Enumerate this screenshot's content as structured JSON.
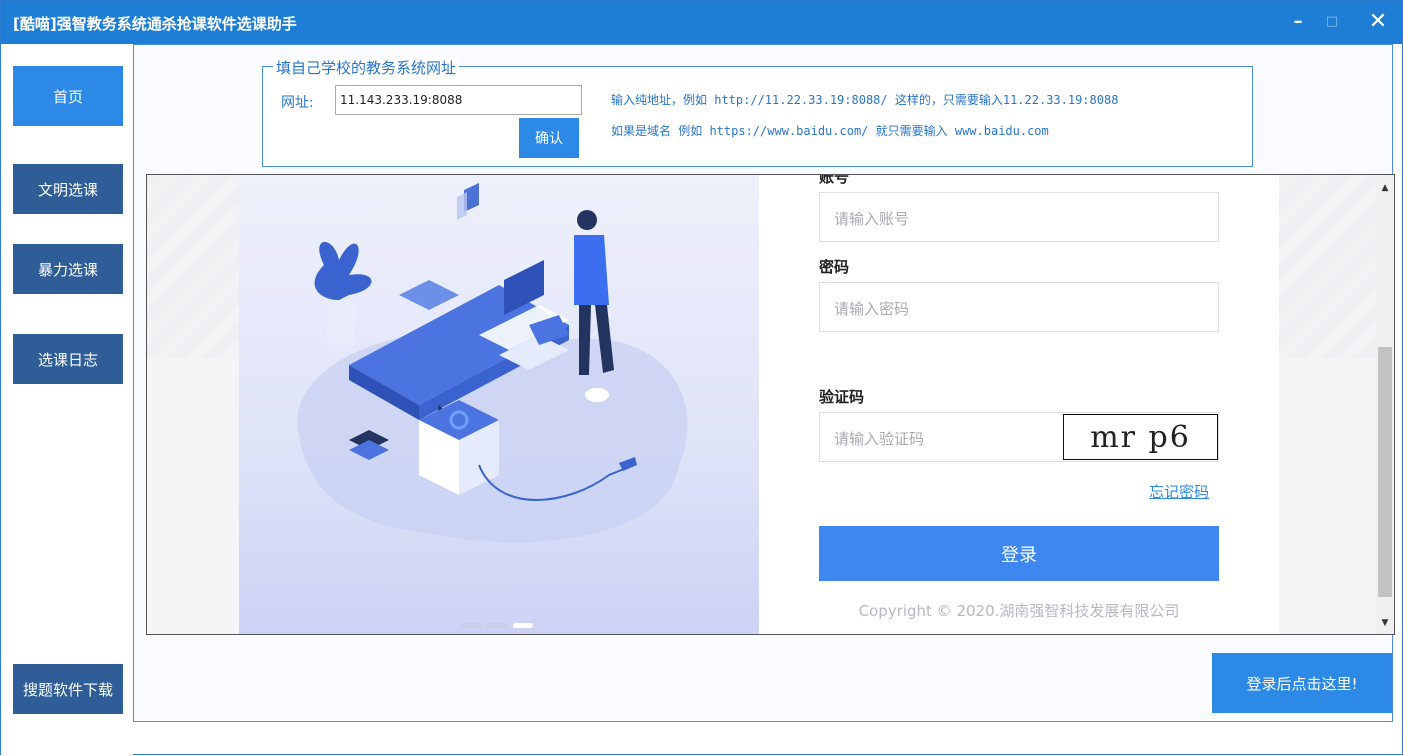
{
  "window": {
    "title": "[酷喵]强智教务系统通杀抢课软件选课助手",
    "controls": {
      "minimize": "–",
      "maximize": "□",
      "close": "✕"
    }
  },
  "sidebar": {
    "items": [
      {
        "label": "首页",
        "active": true
      },
      {
        "label": "文明选课"
      },
      {
        "label": "暴力选课"
      },
      {
        "label": "选课日志"
      }
    ],
    "download_label": "搜题软件下载"
  },
  "url_panel": {
    "legend": "填自己学校的教务系统网址",
    "field_label": "网址:",
    "url_value": "11.143.233.19:8088",
    "confirm_label": "确认",
    "hint1": "输入纯地址，例如 http://11.22.33.19:8088/ 这样的，只需要输入11.22.33.19:8088",
    "hint2": "如果是域名 例如 https://www.baidu.com/  就只需要输入 www.baidu.com"
  },
  "login_page": {
    "account_label": "账号",
    "account_placeholder": "请输入账号",
    "password_label": "密码",
    "password_placeholder": "请输入密码",
    "captcha_label": "验证码",
    "captcha_placeholder": "请输入验证码",
    "captcha_text": "mr p6",
    "forgot_label": "忘记密码",
    "login_label": "登录",
    "copyright": "Copyright © 2020.湖南强智科技发展有限公司",
    "carousel": {
      "count": 3,
      "active_index": 2
    }
  },
  "after_login_label": "登录后点击这里!",
  "colors": {
    "titlebar": "#1e7ed6",
    "nav_active": "#2c8ae6",
    "nav_inactive": "#2e5d97",
    "login_button": "#3e87f0"
  }
}
